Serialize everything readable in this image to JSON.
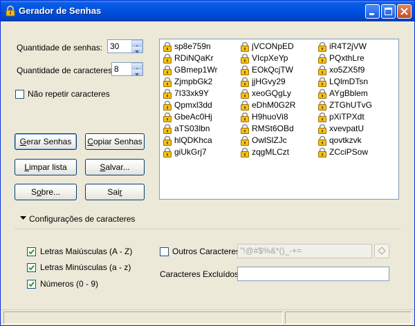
{
  "window": {
    "title": "Gerador de Senhas"
  },
  "options": {
    "quantity_label": "Quantidade de senhas:",
    "quantity_value": "30",
    "length_label": "Quantidade de caracteres:",
    "length_value": "8",
    "no_repeat_label": "Não repetir caracteres",
    "no_repeat_checked": false
  },
  "buttons": {
    "generate": {
      "pre": "",
      "key": "G",
      "post": "erar Senhas"
    },
    "copy": {
      "pre": "",
      "key": "C",
      "post": "opiar Senhas"
    },
    "clear": {
      "pre": "",
      "key": "L",
      "post": "impar lista"
    },
    "save": {
      "pre": "",
      "key": "S",
      "post": "alvar..."
    },
    "about": {
      "pre": "S",
      "key": "o",
      "post": "bre..."
    },
    "exit": {
      "pre": "Sai",
      "key": "r",
      "post": ""
    }
  },
  "passwords": {
    "col1": [
      "sp8e759n",
      "RDiNQaKr",
      "GBmep1Wr",
      "ZjmpbGk2",
      "7I33xk9Y",
      "Qpmxl3dd",
      "GbeAc0Hj",
      "aTS03lbn",
      "hlQDKhca",
      "giUkGrj7"
    ],
    "col2": [
      "jVCONpED",
      "VIcpXeYp",
      "EOkQcjTW",
      "jjHGvy29",
      "xeoGQgLy",
      "eDhM0G2R",
      "H9huoVi8",
      "RMSt6OBd",
      "OwlSlZJc",
      "zqgMLCzt"
    ],
    "col3": [
      "iR4T2jVW",
      "PQxthLre",
      "xo5ZX5f9",
      "LQlmDTsn",
      "AYgBblem",
      "ZTGhUTvG",
      "pXiTPXdt",
      "xvevpatU",
      "qovtkzvk",
      "ZCciPSow"
    ]
  },
  "config": {
    "title": "Configurações de caracteres",
    "uppercase": {
      "label": "Letras Maiúsculas (A - Z)",
      "checked": true
    },
    "lowercase": {
      "label": "Letras Minúsculas (a - z)",
      "checked": true
    },
    "numbers": {
      "label": "Números (0 - 9)",
      "checked": true
    },
    "other": {
      "label": "Outros Caracteres",
      "checked": false,
      "value": "\"!@#$%&*()_-+="
    },
    "excluded": {
      "label": "Caracteres Excluídos",
      "value": ""
    }
  },
  "colors": {
    "title_bar": "#0054e3",
    "face": "#ece9d8",
    "check": "#21a121"
  }
}
